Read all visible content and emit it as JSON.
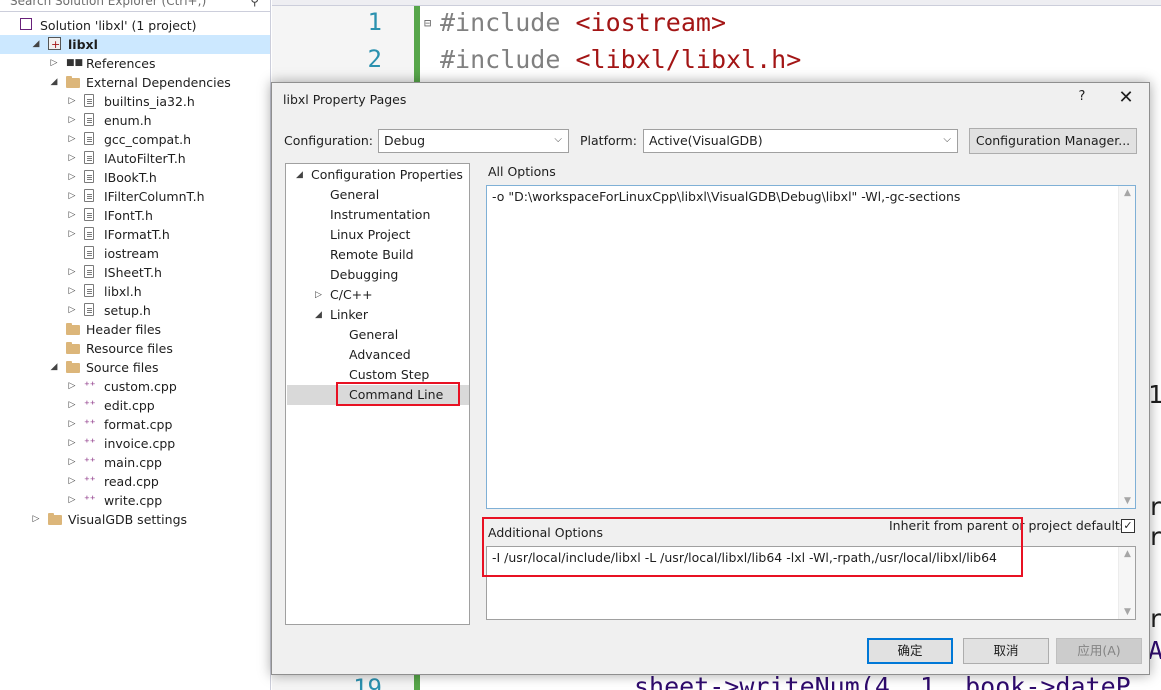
{
  "solution_explorer": {
    "search_placeholder": "Search Solution Explorer (Ctrl+;)",
    "items": [
      {
        "label": "Solution 'libxl' (1 project)",
        "icon": "solution-icon"
      },
      {
        "label": "libxl",
        "icon": "project-icon"
      },
      {
        "label": "References",
        "icon": "references-icon"
      },
      {
        "label": "External Dependencies",
        "icon": "folder-icon"
      },
      {
        "label": "builtins_ia32.h",
        "icon": "header-file-icon"
      },
      {
        "label": "enum.h",
        "icon": "header-file-icon"
      },
      {
        "label": "gcc_compat.h",
        "icon": "header-file-icon"
      },
      {
        "label": "IAutoFilterT.h",
        "icon": "header-file-icon"
      },
      {
        "label": "IBookT.h",
        "icon": "header-file-icon"
      },
      {
        "label": "IFilterColumnT.h",
        "icon": "header-file-icon"
      },
      {
        "label": "IFontT.h",
        "icon": "header-file-icon"
      },
      {
        "label": "IFormatT.h",
        "icon": "header-file-icon"
      },
      {
        "label": "iostream",
        "icon": "header-file-icon"
      },
      {
        "label": "ISheetT.h",
        "icon": "header-file-icon"
      },
      {
        "label": "libxl.h",
        "icon": "header-file-icon"
      },
      {
        "label": "setup.h",
        "icon": "header-file-icon"
      },
      {
        "label": "Header files",
        "icon": "folder-icon"
      },
      {
        "label": "Resource files",
        "icon": "folder-icon"
      },
      {
        "label": "Source files",
        "icon": "folder-icon"
      },
      {
        "label": "custom.cpp",
        "icon": "cpp-file-icon"
      },
      {
        "label": "edit.cpp",
        "icon": "cpp-file-icon"
      },
      {
        "label": "format.cpp",
        "icon": "cpp-file-icon"
      },
      {
        "label": "invoice.cpp",
        "icon": "cpp-file-icon"
      },
      {
        "label": "main.cpp",
        "icon": "cpp-file-icon"
      },
      {
        "label": "read.cpp",
        "icon": "cpp-file-icon"
      },
      {
        "label": "write.cpp",
        "icon": "cpp-file-icon"
      },
      {
        "label": "VisualGDB settings",
        "icon": "folder-icon"
      }
    ]
  },
  "editor": {
    "lines": [
      {
        "no": "1",
        "directive": "#include",
        "target": "<iostream>"
      },
      {
        "no": "2",
        "directive": "#include",
        "target": "<libxl/libxl.h>"
      }
    ],
    "bottom_line_no": "19",
    "bottom_code": "sheet->writeNum(4, 1, book->dateP",
    "peek_fragments": [
      "1",
      "r",
      "r",
      "r",
      "A"
    ]
  },
  "dialog": {
    "title": "libxl Property Pages",
    "help_label": "?",
    "close_label": "✕",
    "configuration_label": "Configuration:",
    "configuration_value": "Debug",
    "platform_label": "Platform:",
    "platform_value": "Active(VisualGDB)",
    "config_manager_label": "Configuration Manager...",
    "nav": [
      {
        "label": "Configuration Properties",
        "expanded": true
      },
      {
        "label": "General"
      },
      {
        "label": "Instrumentation"
      },
      {
        "label": "Linux Project"
      },
      {
        "label": "Remote Build"
      },
      {
        "label": "Debugging"
      },
      {
        "label": "C/C++",
        "expanded": false
      },
      {
        "label": "Linker",
        "expanded": true
      },
      {
        "label": "General"
      },
      {
        "label": "Advanced"
      },
      {
        "label": "Custom Step"
      },
      {
        "label": "Command Line",
        "selected": true
      }
    ],
    "all_options_label": "All Options",
    "all_options_value": "-o \"D:\\workspaceForLinuxCpp\\libxl\\VisualGDB\\Debug\\libxl\" -Wl,-gc-sections",
    "additional_options_label": "Additional Options",
    "inherit_label": "Inherit from parent or project defaults",
    "inherit_checked": "✓",
    "additional_options_value": "-I /usr/local/include/libxl -L /usr/local/libxl/lib64 -lxl -Wl,-rpath,/usr/local/libxl/lib64",
    "ok_label": "确定",
    "cancel_label": "取消",
    "apply_label": "应用(A)"
  },
  "colors": {
    "highlight_box": "#e81123",
    "selection": "#cce8ff",
    "accent": "#0078d7"
  }
}
